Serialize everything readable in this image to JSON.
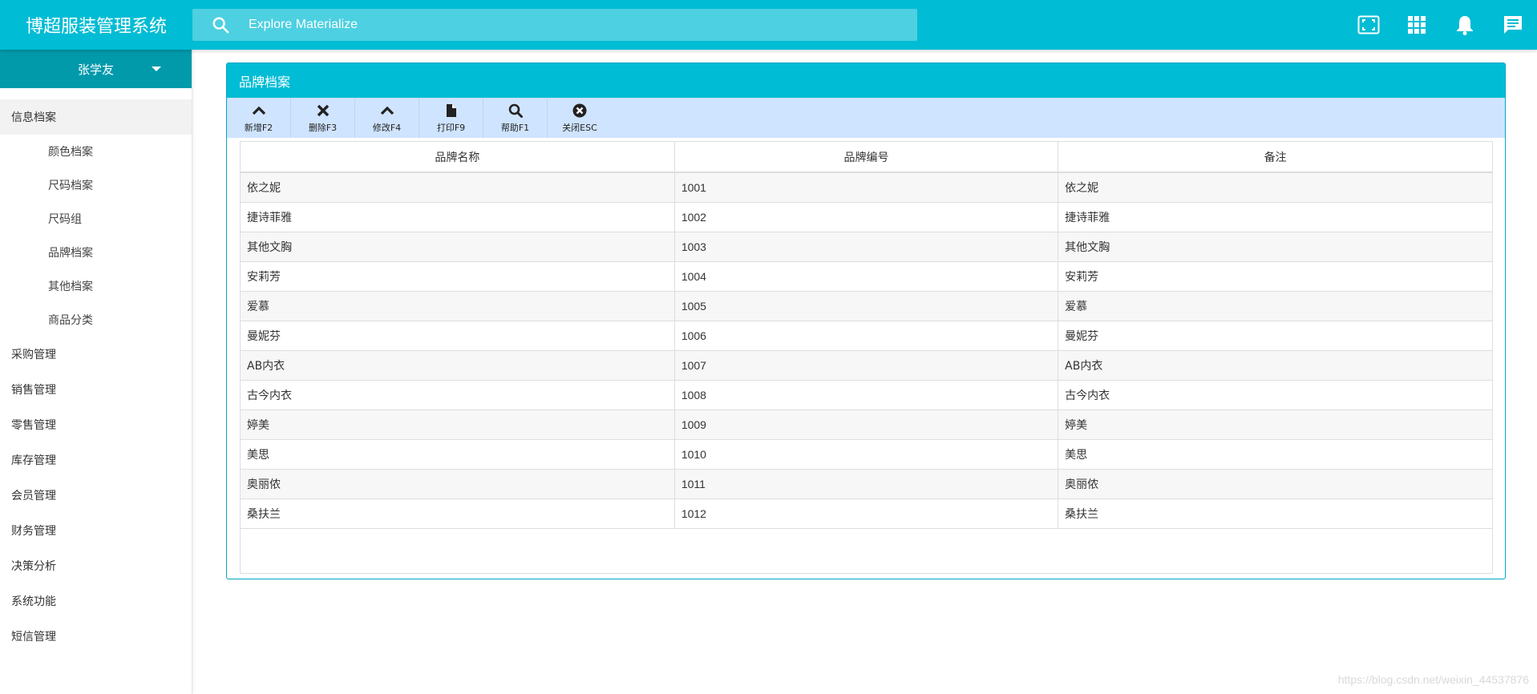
{
  "app": {
    "title": "博超服装管理系统"
  },
  "search": {
    "placeholder": "Explore Materialize"
  },
  "topbar_icons": [
    "fullscreen-icon",
    "apps-grid-icon",
    "notifications-icon",
    "chat-icon"
  ],
  "user": {
    "name": "张学友"
  },
  "sidebar": {
    "menu": [
      {
        "label": "信息档案",
        "active": true
      },
      {
        "label": "采购管理"
      },
      {
        "label": "销售管理"
      },
      {
        "label": "零售管理"
      },
      {
        "label": "库存管理"
      },
      {
        "label": "会员管理"
      },
      {
        "label": "财务管理"
      },
      {
        "label": "决策分析"
      },
      {
        "label": "系统功能"
      },
      {
        "label": "短信管理"
      }
    ],
    "submenu": [
      {
        "label": "颜色档案"
      },
      {
        "label": "尺码档案"
      },
      {
        "label": "尺码组"
      },
      {
        "label": "品牌档案"
      },
      {
        "label": "其他档案"
      },
      {
        "label": "商品分类"
      }
    ]
  },
  "panel": {
    "title": "品牌档案",
    "toolbar": [
      {
        "label": "新增F2",
        "icon": "chevron-up-icon"
      },
      {
        "label": "删除F3",
        "icon": "close-x-icon"
      },
      {
        "label": "修改F4",
        "icon": "chevron-up-icon"
      },
      {
        "label": "打印F9",
        "icon": "file-icon"
      },
      {
        "label": "帮助F1",
        "icon": "search-icon"
      },
      {
        "label": "关闭ESC",
        "icon": "close-circle-icon"
      }
    ],
    "table": {
      "headers": [
        "品牌名称",
        "品牌编号",
        "备注"
      ],
      "rows": [
        [
          "依之妮",
          "1001",
          "依之妮"
        ],
        [
          "捷诗菲雅",
          "1002",
          "捷诗菲雅"
        ],
        [
          "其他文胸",
          "1003",
          "其他文胸"
        ],
        [
          "安莉芳",
          "1004",
          "安莉芳"
        ],
        [
          "爱慕",
          "1005",
          "爱慕"
        ],
        [
          "曼妮芬",
          "1006",
          "曼妮芬"
        ],
        [
          "AB内衣",
          "1007",
          "AB内衣"
        ],
        [
          "古今内衣",
          "1008",
          "古今内衣"
        ],
        [
          "婷美",
          "1009",
          "婷美"
        ],
        [
          "美思",
          "1010",
          "美思"
        ],
        [
          "奥丽侬",
          "1011",
          "奥丽侬"
        ],
        [
          "桑扶兰",
          "1012",
          "桑扶兰"
        ]
      ]
    }
  },
  "watermark": "https://blog.csdn.net/weixin_44537876",
  "colors": {
    "primary": "#00bcd4",
    "user_bar": "#009aab",
    "search_bg": "#4dd0e1",
    "toolbar_bg": "#cfe4ff"
  }
}
